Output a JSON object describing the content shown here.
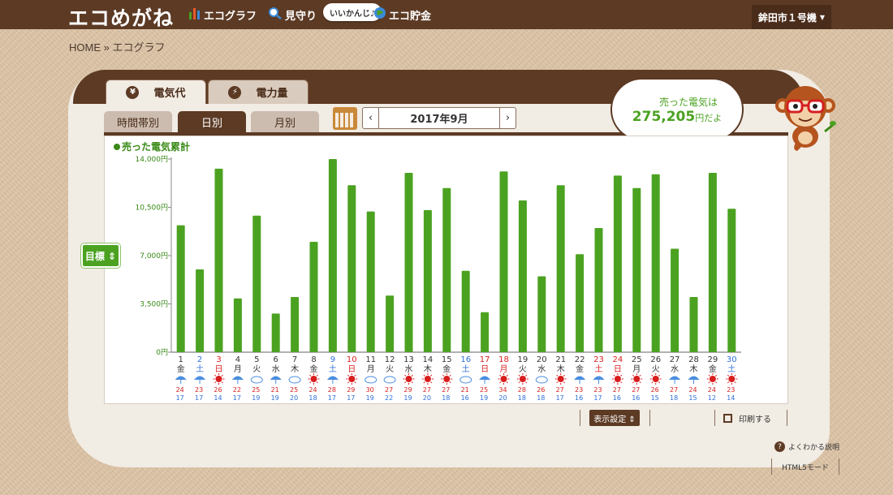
{
  "header": {
    "logo": "エコめがね",
    "nav": [
      {
        "label": "エコグラフ",
        "icon": "bar-chart-icon"
      },
      {
        "label": "見守り",
        "icon": "magnifier-icon"
      },
      {
        "label": "エコ貯金",
        "icon": "globe-icon"
      }
    ],
    "badge": "いいかんじ♪",
    "device": "鉾田市１号機"
  },
  "breadcrumb": "HOME » エコグラフ",
  "tabs": {
    "main": [
      {
        "label": "電気代",
        "icon": "yen-icon",
        "active": true
      },
      {
        "label": "電力量",
        "icon": "lightning-icon",
        "active": false
      }
    ],
    "sub": [
      {
        "label": "時間帯別",
        "active": false
      },
      {
        "label": "日別",
        "active": true
      },
      {
        "label": "月別",
        "active": false
      }
    ]
  },
  "date_nav": {
    "label": "2017年9月",
    "prev": "‹",
    "next": "›"
  },
  "speech": {
    "label": "売った電気は",
    "amount": "275,205",
    "suffix": "円だよ"
  },
  "target_button": "目標 ⇕",
  "legend": "売った電気累計",
  "footer": {
    "display_settings": "表示設定 ⇕",
    "print": "印刷する",
    "help": "よくわかる説明",
    "html5": "HTML5モード"
  },
  "colors": {
    "bar": "#4ba221",
    "brown": "#5c3a24",
    "sat": "#2e6fd8",
    "holiday": "#d81e1e"
  },
  "chart_data": {
    "type": "bar",
    "ylim": [
      0,
      14000
    ],
    "yticks": [
      "0円",
      "3,500円",
      "7,000円",
      "10,500円",
      "14,000円"
    ],
    "ytick_values": [
      0,
      3500,
      7000,
      10500,
      14000
    ],
    "days": [
      {
        "d": "1",
        "w": "金",
        "c": "n",
        "v": 9200,
        "wx": "rain",
        "hi": "24",
        "lo": "17"
      },
      {
        "d": "2",
        "w": "土",
        "c": "sat",
        "v": 6000,
        "wx": "rain",
        "hi": "23",
        "lo": "17"
      },
      {
        "d": "3",
        "w": "日",
        "c": "hol",
        "v": 13300,
        "wx": "sun",
        "hi": "26",
        "lo": "14"
      },
      {
        "d": "4",
        "w": "月",
        "c": "n",
        "v": 3900,
        "wx": "rain",
        "hi": "22",
        "lo": "17"
      },
      {
        "d": "5",
        "w": "火",
        "c": "n",
        "v": 9900,
        "wx": "cloud",
        "hi": "25",
        "lo": "19"
      },
      {
        "d": "6",
        "w": "水",
        "c": "n",
        "v": 2800,
        "wx": "rain",
        "hi": "21",
        "lo": "19"
      },
      {
        "d": "7",
        "w": "木",
        "c": "n",
        "v": 4000,
        "wx": "cloud",
        "hi": "25",
        "lo": "20"
      },
      {
        "d": "8",
        "w": "金",
        "c": "n",
        "v": 8000,
        "wx": "sun",
        "hi": "24",
        "lo": "18"
      },
      {
        "d": "9",
        "w": "土",
        "c": "sat",
        "v": 14000,
        "wx": "rain",
        "hi": "28",
        "lo": "17"
      },
      {
        "d": "10",
        "w": "日",
        "c": "hol",
        "v": 12100,
        "wx": "sun",
        "hi": "29",
        "lo": "17"
      },
      {
        "d": "11",
        "w": "月",
        "c": "n",
        "v": 10200,
        "wx": "cloud",
        "hi": "30",
        "lo": "19"
      },
      {
        "d": "12",
        "w": "火",
        "c": "n",
        "v": 4100,
        "wx": "cloud",
        "hi": "27",
        "lo": "22"
      },
      {
        "d": "13",
        "w": "水",
        "c": "n",
        "v": 13000,
        "wx": "sun",
        "hi": "29",
        "lo": "19"
      },
      {
        "d": "14",
        "w": "木",
        "c": "n",
        "v": 10300,
        "wx": "sun",
        "hi": "27",
        "lo": "20"
      },
      {
        "d": "15",
        "w": "金",
        "c": "n",
        "v": 11900,
        "wx": "sun",
        "hi": "27",
        "lo": "18"
      },
      {
        "d": "16",
        "w": "土",
        "c": "sat",
        "v": 5900,
        "wx": "cloud",
        "hi": "21",
        "lo": "16"
      },
      {
        "d": "17",
        "w": "日",
        "c": "hol",
        "v": 2900,
        "wx": "rain",
        "hi": "25",
        "lo": "19"
      },
      {
        "d": "18",
        "w": "月",
        "c": "hol",
        "v": 13100,
        "wx": "sun",
        "hi": "34",
        "lo": "20"
      },
      {
        "d": "19",
        "w": "火",
        "c": "n",
        "v": 11000,
        "wx": "sun",
        "hi": "28",
        "lo": "18"
      },
      {
        "d": "20",
        "w": "水",
        "c": "n",
        "v": 5500,
        "wx": "cloud",
        "hi": "26",
        "lo": "18"
      },
      {
        "d": "21",
        "w": "木",
        "c": "n",
        "v": 12100,
        "wx": "sun",
        "hi": "27",
        "lo": "17"
      },
      {
        "d": "22",
        "w": "金",
        "c": "n",
        "v": 7100,
        "wx": "rain",
        "hi": "23",
        "lo": "16"
      },
      {
        "d": "23",
        "w": "土",
        "c": "hol",
        "v": 9000,
        "wx": "rain",
        "hi": "23",
        "lo": "17"
      },
      {
        "d": "24",
        "w": "日",
        "c": "hol",
        "v": 12800,
        "wx": "sun",
        "hi": "27",
        "lo": "16"
      },
      {
        "d": "25",
        "w": "月",
        "c": "n",
        "v": 11900,
        "wx": "sun",
        "hi": "27",
        "lo": "16"
      },
      {
        "d": "26",
        "w": "火",
        "c": "n",
        "v": 12900,
        "wx": "sun",
        "hi": "26",
        "lo": "15"
      },
      {
        "d": "27",
        "w": "水",
        "c": "n",
        "v": 7500,
        "wx": "rain",
        "hi": "27",
        "lo": "18"
      },
      {
        "d": "28",
        "w": "木",
        "c": "n",
        "v": 4000,
        "wx": "rain",
        "hi": "24",
        "lo": "15"
      },
      {
        "d": "29",
        "w": "金",
        "c": "n",
        "v": 13000,
        "wx": "sun",
        "hi": "24",
        "lo": "12"
      },
      {
        "d": "30",
        "w": "土",
        "c": "sat",
        "v": 10400,
        "wx": "sun",
        "hi": "23",
        "lo": "14"
      }
    ]
  }
}
